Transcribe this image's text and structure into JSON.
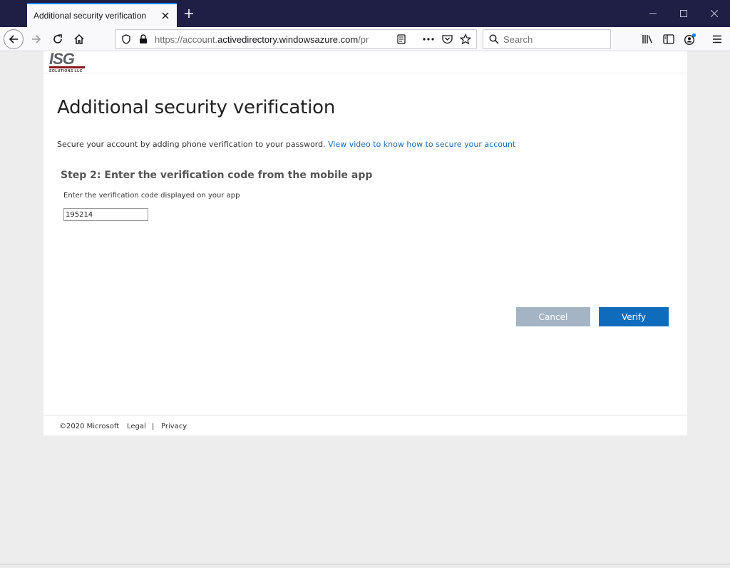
{
  "browser": {
    "tab_title": "Additional security verification",
    "url_prefix": "https://account.",
    "url_domain": "activedirectory.windowsazure.com",
    "url_suffix": "/pr",
    "search_placeholder": "Search",
    "accent": "#0a84ff",
    "chrome_bg": "#1f1f46"
  },
  "logo": {
    "text": "ISG",
    "subtext": "SOLUTIONS LLC"
  },
  "page": {
    "title": "Additional security verification",
    "intro_text": "Secure your account by adding phone verification to your password. ",
    "intro_link": "View video to know how to secure your account",
    "step_heading": "Step 2: Enter the verification code from the mobile app",
    "code_label": "Enter the verification code displayed on your app",
    "code_value": "195214",
    "cancel_label": "Cancel",
    "verify_label": "Verify",
    "primary_color": "#0f6cbd",
    "link_color": "#1a6ab8"
  },
  "footer": {
    "copyright": "©2020 Microsoft",
    "legal": "Legal",
    "separator": "|",
    "privacy": "Privacy"
  }
}
